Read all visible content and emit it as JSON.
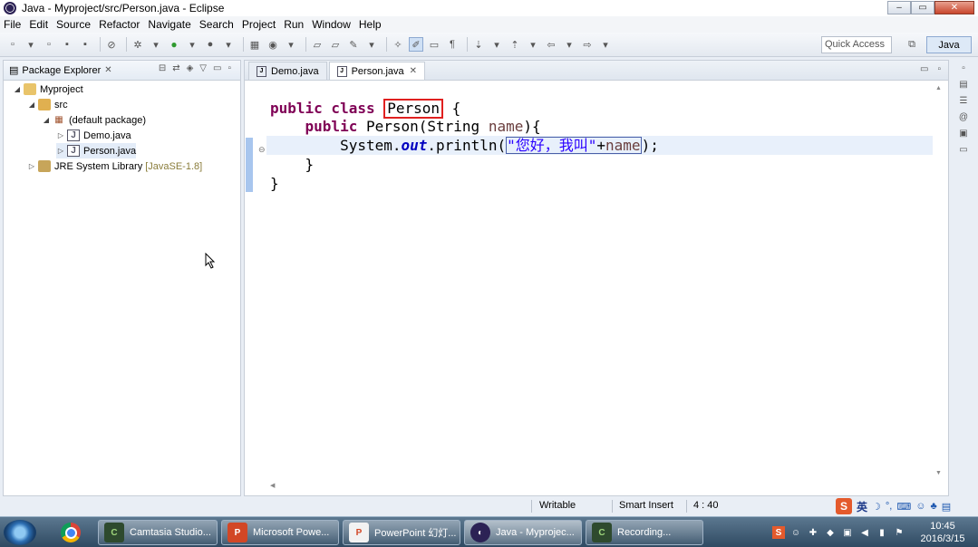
{
  "window": {
    "title": "Java - Myproject/src/Person.java - Eclipse"
  },
  "menu": [
    "File",
    "Edit",
    "Source",
    "Refactor",
    "Navigate",
    "Search",
    "Project",
    "Run",
    "Window",
    "Help"
  ],
  "toolbar": {
    "quick_access": "Quick Access",
    "perspective": "Java"
  },
  "package_explorer": {
    "tab_label": "Package Explorer",
    "tree": {
      "project": "Myproject",
      "src": "src",
      "package": "(default package)",
      "file1": "Demo.java",
      "file2": "Person.java",
      "jre": "JRE System Library",
      "jre_version": "[JavaSE-1.8]"
    }
  },
  "editor": {
    "tabs": [
      "Demo.java",
      "Person.java"
    ],
    "active_tab": 1,
    "code": {
      "l1_kw": "public class ",
      "l1_name": "Person",
      "l1_end": " {",
      "l2_indent": "    ",
      "l2_kw": "public",
      "l2_mid": " Person(String ",
      "l2_param": "name",
      "l2_end": "){",
      "l3_indent": "        ",
      "l3_sys": "System.",
      "l3_field": "out",
      "l3_call": ".println(",
      "l3_str": "\"您好，我叫\"",
      "l3_plus": "+",
      "l3_param": "name",
      "l3_end": ");",
      "l4": "    }",
      "l5": "}"
    }
  },
  "status": {
    "writable": "Writable",
    "insert_mode": "Smart Insert",
    "position": "4 : 40"
  },
  "ime": {
    "mode": "英"
  },
  "taskbar": {
    "items": [
      "Camtasia Studio...",
      "Microsoft Powe...",
      "PowerPoint 幻灯...",
      "Java - Myprojec...",
      "Recording..."
    ],
    "time": "10:45",
    "date": "2016/3/15"
  }
}
